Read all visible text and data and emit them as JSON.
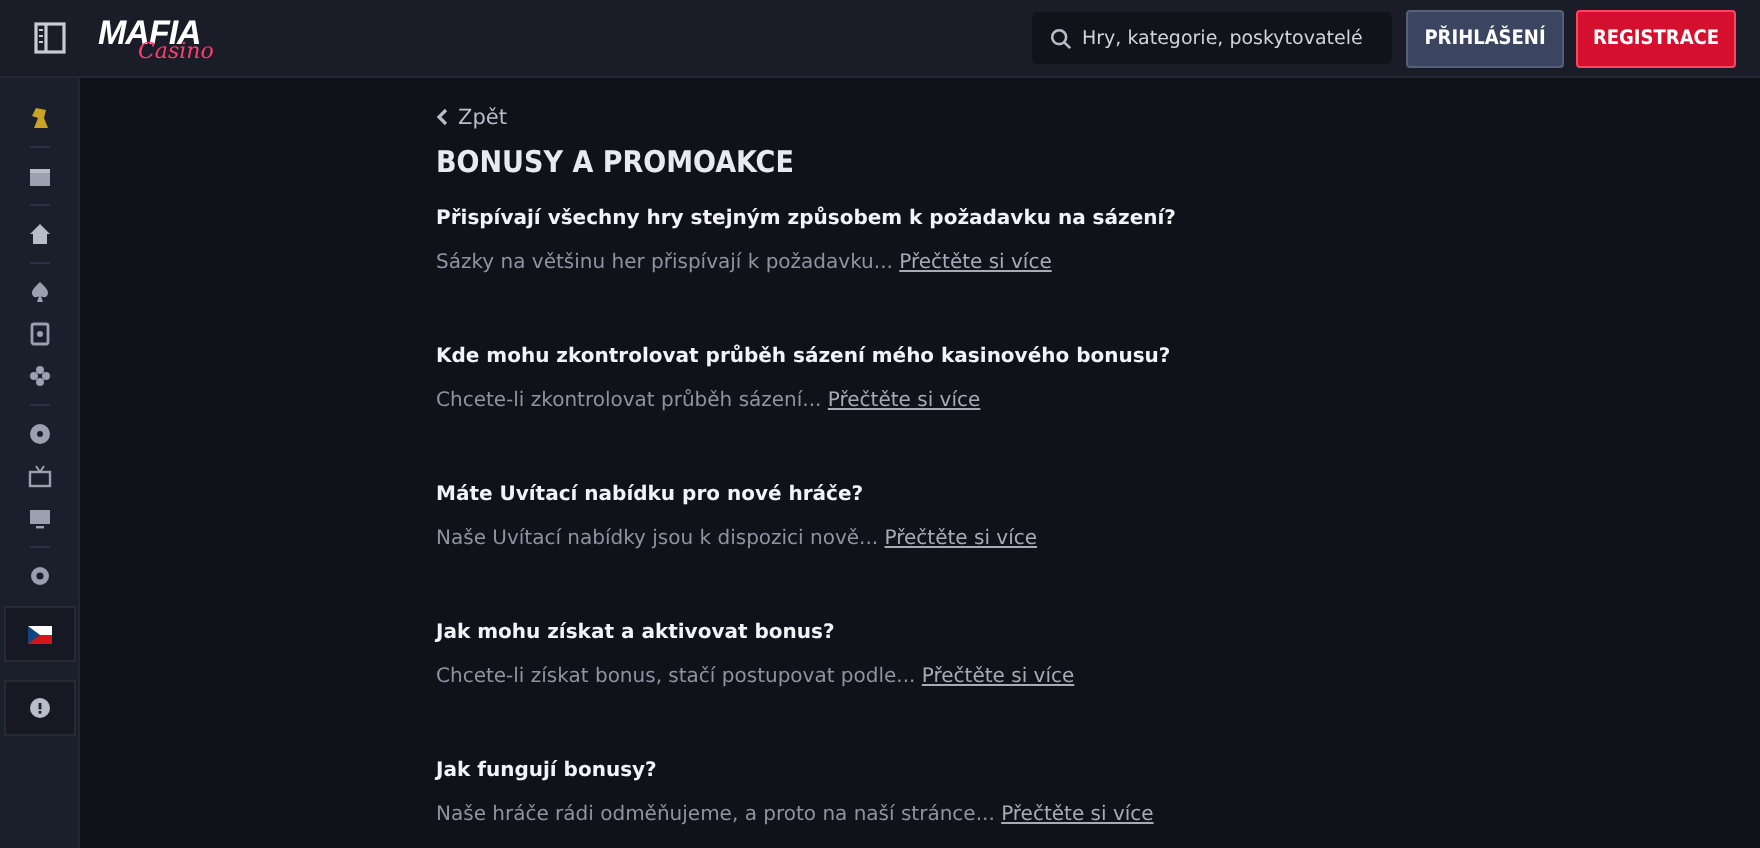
{
  "header": {
    "logo": {
      "main": "MAFIA",
      "script": "Casino"
    },
    "search": {
      "placeholder": "Hry, kategorie, poskytovatelé"
    },
    "login_button": "PŘIHLÁŠENÍ",
    "register_button": "REGISTRACE"
  },
  "back_link": "Zpět",
  "title": "BONUSY A PROMOAKCE",
  "faq": [
    {
      "question": "Přispívají všechny hry stejným způsobem k požadavku na sázení?",
      "excerpt": "Sázky na většinu her přispívají k požadavku...",
      "link": "Přečtěte si více"
    },
    {
      "question": "Kde mohu zkontrolovat průběh sázení mého kasinového bonusu?",
      "excerpt": "Chcete-li zkontrolovat průběh sázení...",
      "link": "Přečtěte si více"
    },
    {
      "question": "Máte Uvítací nabídku pro nové hráče?",
      "excerpt": "Naše Uvítací nabídky jsou k dispozici nově...",
      "link": "Přečtěte si více"
    },
    {
      "question": "Jak mohu získat a aktivovat bonus?",
      "excerpt": "Chcete-li získat bonus, stačí postupovat podle...",
      "link": "Přečtěte si více"
    },
    {
      "question": "Jak fungují bonusy?",
      "excerpt": "Naše hráče rádi odměňujeme, a proto na naší stránce...",
      "link": "Přečtěte si více"
    }
  ]
}
